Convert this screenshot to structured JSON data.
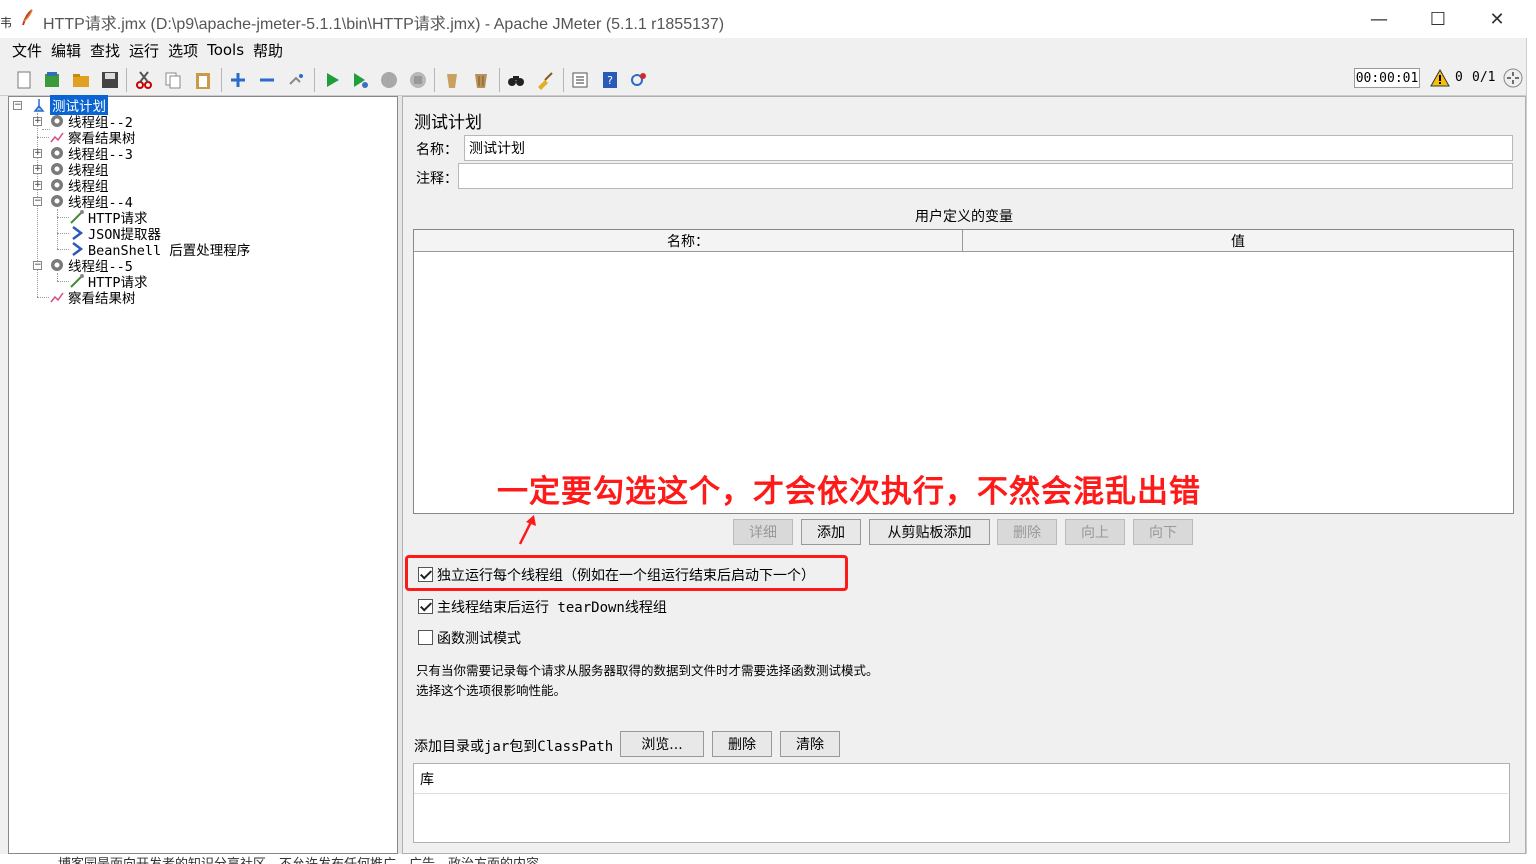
{
  "window": {
    "title": "HTTP请求.jmx (D:\\p9\\apache-jmeter-5.1.1\\bin\\HTTP请求.jmx) - Apache JMeter (5.1.1 r1855137)",
    "minimize": "—",
    "maximize": "☐",
    "close": "✕",
    "edge_char": "韦"
  },
  "menu": [
    "文件",
    "编辑",
    "查找",
    "运行",
    "选项",
    "Tools",
    "帮助"
  ],
  "status": {
    "timer": "00:00:01",
    "error_count": "0",
    "threads": "0/1"
  },
  "tree": {
    "root": "测试计划",
    "items": [
      {
        "label": "线程组--2"
      },
      {
        "label": "察看结果树"
      },
      {
        "label": "线程组--3"
      },
      {
        "label": "线程组"
      },
      {
        "label": "线程组"
      },
      {
        "label": "线程组--4"
      },
      {
        "label": "HTTP请求"
      },
      {
        "label": "JSON提取器"
      },
      {
        "label": "BeanShell 后置处理程序"
      },
      {
        "label": "线程组--5"
      },
      {
        "label": "HTTP请求"
      },
      {
        "label": "察看结果树"
      }
    ]
  },
  "panel": {
    "heading": "测试计划",
    "name_label": "名称：",
    "name_value": "测试计划",
    "comment_label": "注释：",
    "comment_value": "",
    "vars_title": "用户定义的变量",
    "col_name": "名称：",
    "col_value": "值",
    "buttons": {
      "detail": "详细",
      "add": "添加",
      "add_clipboard": "从剪贴板添加",
      "delete": "删除",
      "up": "向上",
      "down": "向下"
    },
    "checkbox_serial": "独立运行每个线程组（例如在一个组运行结束后启动下一个）",
    "checkbox_teardown": "主线程结束后运行 tearDown线程组",
    "checkbox_functional": "函数测试模式",
    "note_line1": "只有当你需要记录每个请求从服务器取得的数据到文件时才需要选择函数测试模式。",
    "note_line2": "选择这个选项很影响性能。",
    "classpath_label": "添加目录或jar包到ClassPath",
    "browse": "浏览...",
    "cp_delete": "删除",
    "cp_clear": "清除",
    "lib_header": "库"
  },
  "annotation": {
    "text": "一定要勾选这个，才会依次执行，不然会混乱出错",
    "color": "#ff1a1a"
  },
  "bottom_text": "博客园是面向开发者的知识分享社区，不允许发布任何推广、广告、政治方面的内容"
}
